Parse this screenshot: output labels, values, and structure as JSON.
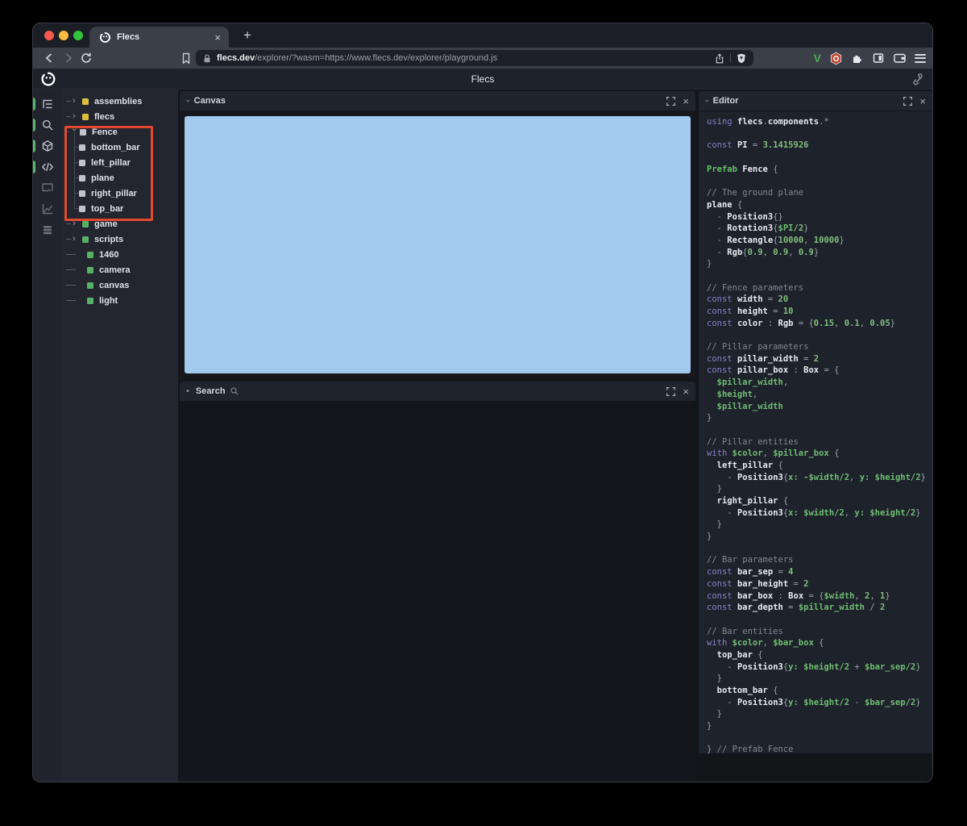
{
  "glyphs": {
    "close": "×",
    "new_tab": "+",
    "chevron": "›",
    "dot": "•"
  },
  "browser": {
    "traffic_lights": [
      "#f3594f",
      "#f5bd3f",
      "#33c13d"
    ],
    "tab_title": "Flecs",
    "url_domain": "flecs.dev",
    "url_path": "/explorer/?wasm=https://www.flecs.dev/explorer/playground.js",
    "extension_v_label": "V"
  },
  "header": {
    "title": "Flecs"
  },
  "sidebar": {
    "icons": [
      {
        "name": "entity-tree-icon",
        "icon": "tree",
        "active": true
      },
      {
        "name": "query-search-icon",
        "icon": "search",
        "active": true
      },
      {
        "name": "entities-cube-icon",
        "icon": "cube",
        "active": true
      },
      {
        "name": "script-code-icon",
        "icon": "code",
        "active": true
      },
      {
        "name": "canvas-screen-icon",
        "icon": "screen",
        "active": false
      },
      {
        "name": "stats-chart-icon",
        "icon": "chart",
        "active": false
      },
      {
        "name": "commands-rows-icon",
        "icon": "rows",
        "active": false
      }
    ]
  },
  "tree": {
    "highlight_color": "#e14a2e",
    "items": [
      {
        "label": "assemblies",
        "state": "collapsed",
        "color": "#dcbe3e",
        "child": false
      },
      {
        "label": "flecs",
        "state": "collapsed",
        "color": "#dcbe3e",
        "child": false
      },
      {
        "label": "Fence",
        "state": "expanded",
        "color": "#c0c4cb",
        "child": false
      },
      {
        "label": "bottom_bar",
        "state": "none",
        "color": "#c0c4cb",
        "child": true
      },
      {
        "label": "left_pillar",
        "state": "none",
        "color": "#c0c4cb",
        "child": true
      },
      {
        "label": "plane",
        "state": "none",
        "color": "#c0c4cb",
        "child": true
      },
      {
        "label": "right_pillar",
        "state": "none",
        "color": "#c0c4cb",
        "child": true
      },
      {
        "label": "top_bar",
        "state": "none",
        "color": "#c0c4cb",
        "child": true
      },
      {
        "label": "game",
        "state": "collapsed",
        "color": "#56b366",
        "child": false
      },
      {
        "label": "scripts",
        "state": "collapsed",
        "color": "#56b366",
        "child": false
      },
      {
        "label": "1460",
        "state": "leaf",
        "color": "#56b366",
        "child": false
      },
      {
        "label": "camera",
        "state": "leaf",
        "color": "#56b366",
        "child": false
      },
      {
        "label": "canvas",
        "state": "leaf",
        "color": "#56b366",
        "child": false
      },
      {
        "label": "light",
        "state": "leaf",
        "color": "#56b366",
        "child": false
      }
    ]
  },
  "panels": {
    "canvas": {
      "title": "Canvas",
      "canvas_color": "#a2c9ee"
    },
    "search": {
      "title": "Search"
    },
    "editor": {
      "title": "Editor",
      "code": [
        [
          [
            "k",
            "using "
          ],
          [
            "i",
            "flecs"
          ],
          [
            "p",
            "."
          ],
          [
            "i",
            "components"
          ],
          [
            "p",
            "."
          ],
          [
            "p",
            "*"
          ]
        ],
        [],
        [
          [
            "k",
            "const "
          ],
          [
            "i",
            "PI "
          ],
          [
            "p",
            "= "
          ],
          [
            "n",
            "3.1415926"
          ]
        ],
        [],
        [
          [
            "g",
            "Prefab "
          ],
          [
            "i",
            "Fence "
          ],
          [
            "p",
            "{"
          ]
        ],
        [],
        [
          [
            "c",
            "// The ground plane"
          ]
        ],
        [
          [
            "i",
            "plane "
          ],
          [
            "p",
            "{"
          ]
        ],
        [
          [
            "p",
            "  - "
          ],
          [
            "i",
            "Position3"
          ],
          [
            "p",
            "{}"
          ]
        ],
        [
          [
            "p",
            "  - "
          ],
          [
            "i",
            "Rotation3"
          ],
          [
            "p",
            "{"
          ],
          [
            "v",
            "$PI"
          ],
          [
            "n",
            "/2"
          ],
          [
            "p",
            "}"
          ]
        ],
        [
          [
            "p",
            "  - "
          ],
          [
            "i",
            "Rectangle"
          ],
          [
            "p",
            "{"
          ],
          [
            "n",
            "10000"
          ],
          [
            "p",
            ", "
          ],
          [
            "n",
            "10000"
          ],
          [
            "p",
            "}"
          ]
        ],
        [
          [
            "p",
            "  - "
          ],
          [
            "i",
            "Rgb"
          ],
          [
            "p",
            "{"
          ],
          [
            "n",
            "0.9"
          ],
          [
            "p",
            ", "
          ],
          [
            "n",
            "0.9"
          ],
          [
            "p",
            ", "
          ],
          [
            "n",
            "0.9"
          ],
          [
            "p",
            "}"
          ]
        ],
        [
          [
            "p",
            "}"
          ]
        ],
        [],
        [
          [
            "c",
            "// Fence parameters"
          ]
        ],
        [
          [
            "k",
            "const "
          ],
          [
            "i",
            "width "
          ],
          [
            "p",
            "= "
          ],
          [
            "n",
            "20"
          ]
        ],
        [
          [
            "k",
            "const "
          ],
          [
            "i",
            "height "
          ],
          [
            "p",
            "= "
          ],
          [
            "n",
            "10"
          ]
        ],
        [
          [
            "k",
            "const "
          ],
          [
            "i",
            "color "
          ],
          [
            "p",
            ": "
          ],
          [
            "i",
            "Rgb "
          ],
          [
            "p",
            "= {"
          ],
          [
            "n",
            "0.15"
          ],
          [
            "p",
            ", "
          ],
          [
            "n",
            "0.1"
          ],
          [
            "p",
            ", "
          ],
          [
            "n",
            "0.05"
          ],
          [
            "p",
            "}"
          ]
        ],
        [],
        [
          [
            "c",
            "// Pillar parameters"
          ]
        ],
        [
          [
            "k",
            "const "
          ],
          [
            "i",
            "pillar_width "
          ],
          [
            "p",
            "= "
          ],
          [
            "n",
            "2"
          ]
        ],
        [
          [
            "k",
            "const "
          ],
          [
            "i",
            "pillar_box "
          ],
          [
            "p",
            ": "
          ],
          [
            "i",
            "Box "
          ],
          [
            "p",
            "= {"
          ]
        ],
        [
          [
            "v",
            "  $pillar_width"
          ],
          [
            "p",
            ","
          ]
        ],
        [
          [
            "v",
            "  $height"
          ],
          [
            "p",
            ","
          ]
        ],
        [
          [
            "v",
            "  $pillar_width"
          ]
        ],
        [
          [
            "p",
            "}"
          ]
        ],
        [],
        [
          [
            "c",
            "// Pillar entities"
          ]
        ],
        [
          [
            "k",
            "with "
          ],
          [
            "v",
            "$color"
          ],
          [
            "p",
            ", "
          ],
          [
            "v",
            "$pillar_box "
          ],
          [
            "p",
            "{"
          ]
        ],
        [
          [
            "i",
            "  left_pillar "
          ],
          [
            "p",
            "{"
          ]
        ],
        [
          [
            "p",
            "    - "
          ],
          [
            "i",
            "Position3"
          ],
          [
            "p",
            "{"
          ],
          [
            "v",
            "x: -$width/2"
          ],
          [
            "p",
            ", "
          ],
          [
            "v",
            "y: $height/2"
          ],
          [
            "p",
            "}"
          ]
        ],
        [
          [
            "p",
            "  }"
          ]
        ],
        [
          [
            "i",
            "  right_pillar "
          ],
          [
            "p",
            "{"
          ]
        ],
        [
          [
            "p",
            "    - "
          ],
          [
            "i",
            "Position3"
          ],
          [
            "p",
            "{"
          ],
          [
            "v",
            "x: $width/2"
          ],
          [
            "p",
            ", "
          ],
          [
            "v",
            "y: $height/2"
          ],
          [
            "p",
            "}"
          ]
        ],
        [
          [
            "p",
            "  }"
          ]
        ],
        [
          [
            "p",
            "}"
          ]
        ],
        [],
        [
          [
            "c",
            "// Bar parameters"
          ]
        ],
        [
          [
            "k",
            "const "
          ],
          [
            "i",
            "bar_sep "
          ],
          [
            "p",
            "= "
          ],
          [
            "n",
            "4"
          ]
        ],
        [
          [
            "k",
            "const "
          ],
          [
            "i",
            "bar_height "
          ],
          [
            "p",
            "= "
          ],
          [
            "n",
            "2"
          ]
        ],
        [
          [
            "k",
            "const "
          ],
          [
            "i",
            "bar_box "
          ],
          [
            "p",
            ": "
          ],
          [
            "i",
            "Box "
          ],
          [
            "p",
            "= {"
          ],
          [
            "v",
            "$width"
          ],
          [
            "p",
            ", "
          ],
          [
            "n",
            "2"
          ],
          [
            "p",
            ", "
          ],
          [
            "n",
            "1"
          ],
          [
            "p",
            "}"
          ]
        ],
        [
          [
            "k",
            "const "
          ],
          [
            "i",
            "bar_depth "
          ],
          [
            "p",
            "= "
          ],
          [
            "v",
            "$pillar_width"
          ],
          [
            "p",
            " / "
          ],
          [
            "n",
            "2"
          ]
        ],
        [],
        [
          [
            "c",
            "// Bar entities"
          ]
        ],
        [
          [
            "k",
            "with "
          ],
          [
            "v",
            "$color"
          ],
          [
            "p",
            ", "
          ],
          [
            "v",
            "$bar_box "
          ],
          [
            "p",
            "{"
          ]
        ],
        [
          [
            "i",
            "  top_bar "
          ],
          [
            "p",
            "{"
          ]
        ],
        [
          [
            "p",
            "    - "
          ],
          [
            "i",
            "Position3"
          ],
          [
            "p",
            "{"
          ],
          [
            "v",
            "y: $height/2"
          ],
          [
            "p",
            " + "
          ],
          [
            "v",
            "$bar_sep/2"
          ],
          [
            "p",
            "}"
          ]
        ],
        [
          [
            "p",
            "  }"
          ]
        ],
        [
          [
            "i",
            "  bottom_bar "
          ],
          [
            "p",
            "{"
          ]
        ],
        [
          [
            "p",
            "    - "
          ],
          [
            "i",
            "Position3"
          ],
          [
            "p",
            "{"
          ],
          [
            "v",
            "y: $height/2"
          ],
          [
            "p",
            " - "
          ],
          [
            "v",
            "$bar_sep/2"
          ],
          [
            "p",
            "}"
          ]
        ],
        [
          [
            "p",
            "  }"
          ]
        ],
        [
          [
            "p",
            "}"
          ]
        ],
        [],
        [
          [
            "p",
            "} "
          ],
          [
            "c",
            "// Prefab Fence"
          ]
        ]
      ]
    }
  }
}
